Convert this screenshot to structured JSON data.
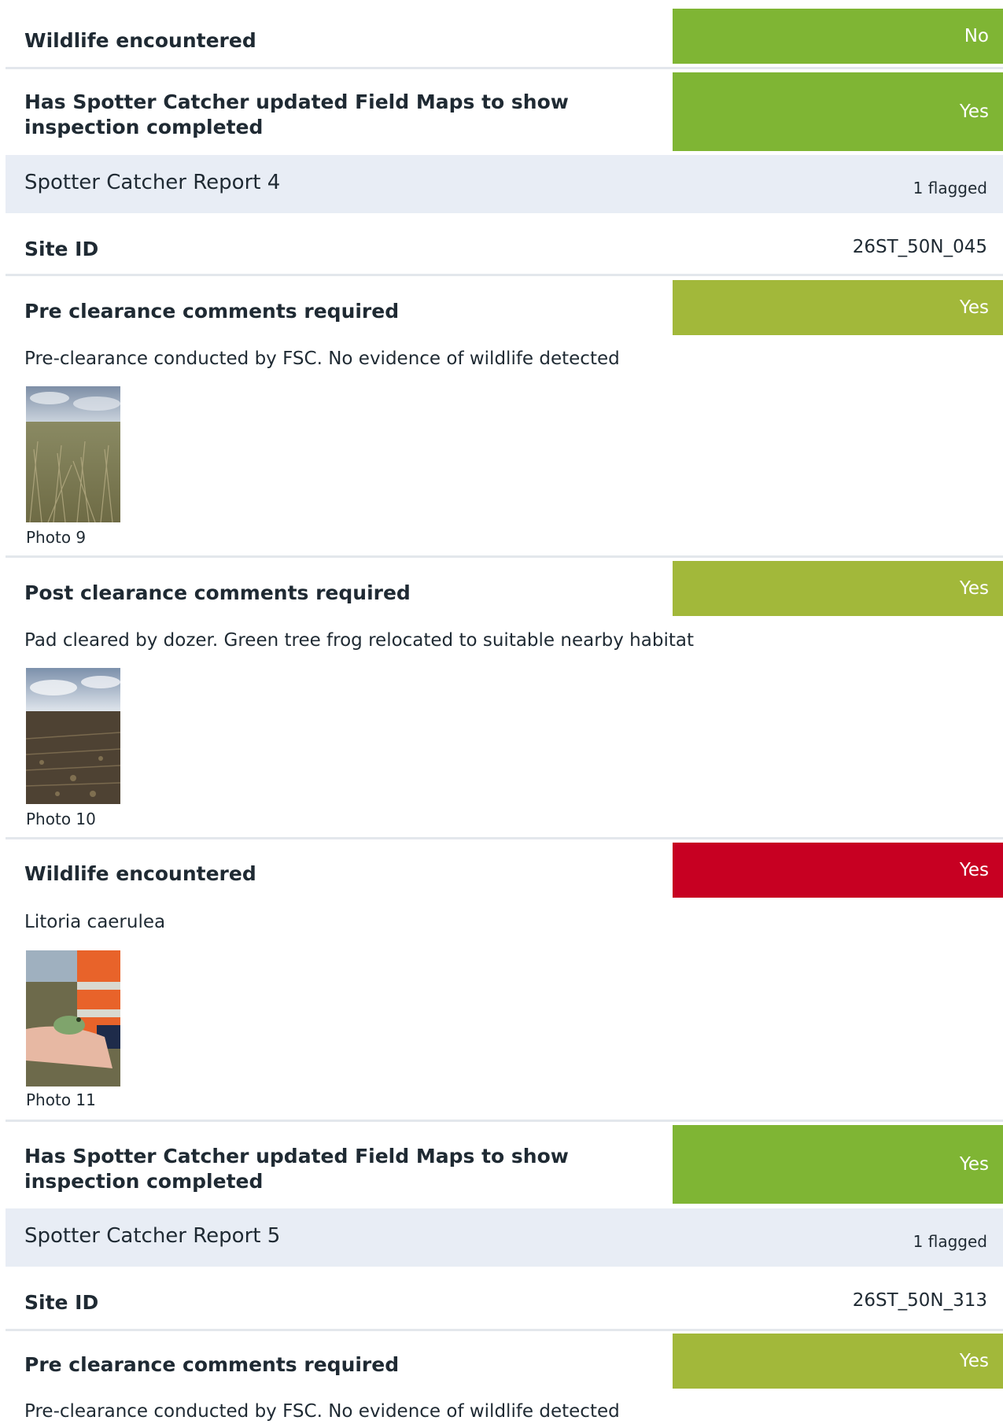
{
  "colors": {
    "green": "#7fb534",
    "olive": "#a2b83a",
    "red": "#c70022",
    "section_bg": "#e8edf5"
  },
  "items": {
    "wildlife1_label": "Wildlife encountered",
    "wildlife1_value": "No",
    "fieldmaps1_label": "Has Spotter Catcher updated Field Maps to show inspection completed",
    "fieldmaps1_value": "Yes",
    "report4_title": "Spotter Catcher Report 4",
    "report4_flag": "1 flagged",
    "site4_label": "Site ID",
    "site4_value": "26ST_50N_045",
    "pre4_label": "Pre clearance comments required",
    "pre4_value": "Yes",
    "pre4_comment": "Pre-clearance conducted by FSC. No evidence of wildlife detected",
    "photo9_caption": "Photo 9",
    "post4_label": "Post clearance comments required",
    "post4_value": "Yes",
    "post4_comment": "Pad cleared by dozer. Green tree frog relocated to suitable nearby habitat",
    "photo10_caption": "Photo 10",
    "wildlife2_label": "Wildlife encountered",
    "wildlife2_value": "Yes",
    "wildlife2_comment": "Litoria caerulea",
    "photo11_caption": "Photo 11",
    "fieldmaps2_label": "Has Spotter Catcher updated Field Maps to show inspection completed",
    "fieldmaps2_value": "Yes",
    "report5_title": "Spotter Catcher Report 5",
    "report5_flag": "1 flagged",
    "site5_label": "Site ID",
    "site5_value": "26ST_50N_313",
    "pre5_label": "Pre clearance comments required",
    "pre5_value": "Yes",
    "pre5_comment": "Pre-clearance conducted by FSC. No evidence of wildlife detected"
  }
}
